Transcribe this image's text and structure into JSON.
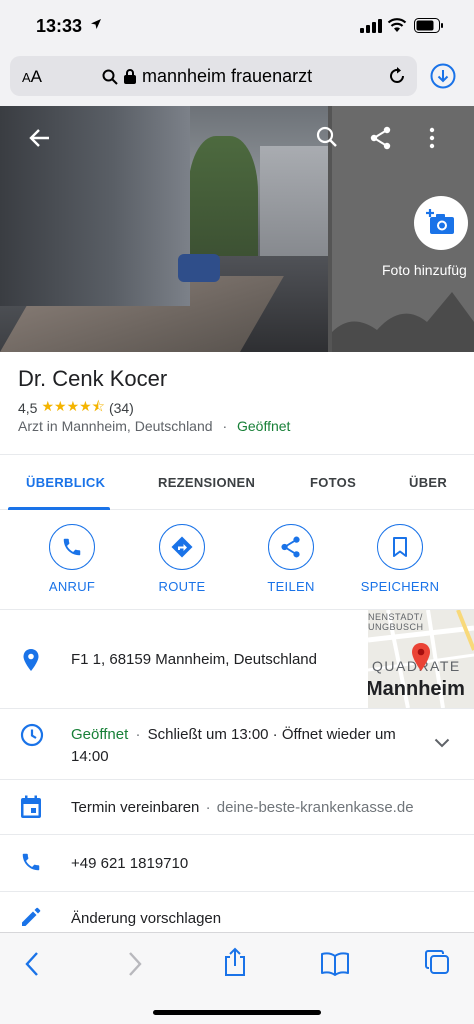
{
  "status_bar": {
    "time": "13:33"
  },
  "browser": {
    "aa_label_large": "A",
    "aa_label_small": "A",
    "url": "mannheim frauenarzt"
  },
  "hero": {
    "add_photo_label": "Foto hinzufüg"
  },
  "place": {
    "name": "Dr. Cenk Kocer",
    "rating": "4,5",
    "stars": "★★★★⯪",
    "review_count": "(34)",
    "category": "Arzt in Mannheim, Deutschland",
    "separator": "·",
    "status": "Geöffnet"
  },
  "tabs": [
    {
      "label": "ÜBERBLICK",
      "active": true
    },
    {
      "label": "REZENSIONEN"
    },
    {
      "label": "FOTOS"
    },
    {
      "label": "ÜBER"
    }
  ],
  "actions": [
    {
      "label": "ANRUF",
      "icon": "phone-icon"
    },
    {
      "label": "ROUTE",
      "icon": "directions-icon"
    },
    {
      "label": "TEILEN",
      "icon": "share-icon"
    },
    {
      "label": "SPEICHERN",
      "icon": "bookmark-icon"
    }
  ],
  "address": {
    "text": "F1 1, 68159 Mannheim, Deutschland"
  },
  "map_thumb": {
    "label_top1": "NENSTADT/",
    "label_top2": "UNGBUSCH",
    "label_mid": "QUADRATE",
    "label_city": "Mannheim"
  },
  "hours": {
    "status": "Geöffnet",
    "sep": "·",
    "line1_rest": "Schließt um 13:00 · Öffnet wieder um",
    "line2": "14:00"
  },
  "appointment": {
    "label": "Termin vereinbaren",
    "sep": "·",
    "site": "deine-beste-krankenkasse.de"
  },
  "phone": {
    "number": "+49 621 1819710"
  },
  "suggest": {
    "label": "Änderung vorschlagen"
  },
  "colors": {
    "accent": "#1a73e8",
    "open_green": "#188038",
    "star": "#f4b400",
    "pin": "#ea4335"
  }
}
